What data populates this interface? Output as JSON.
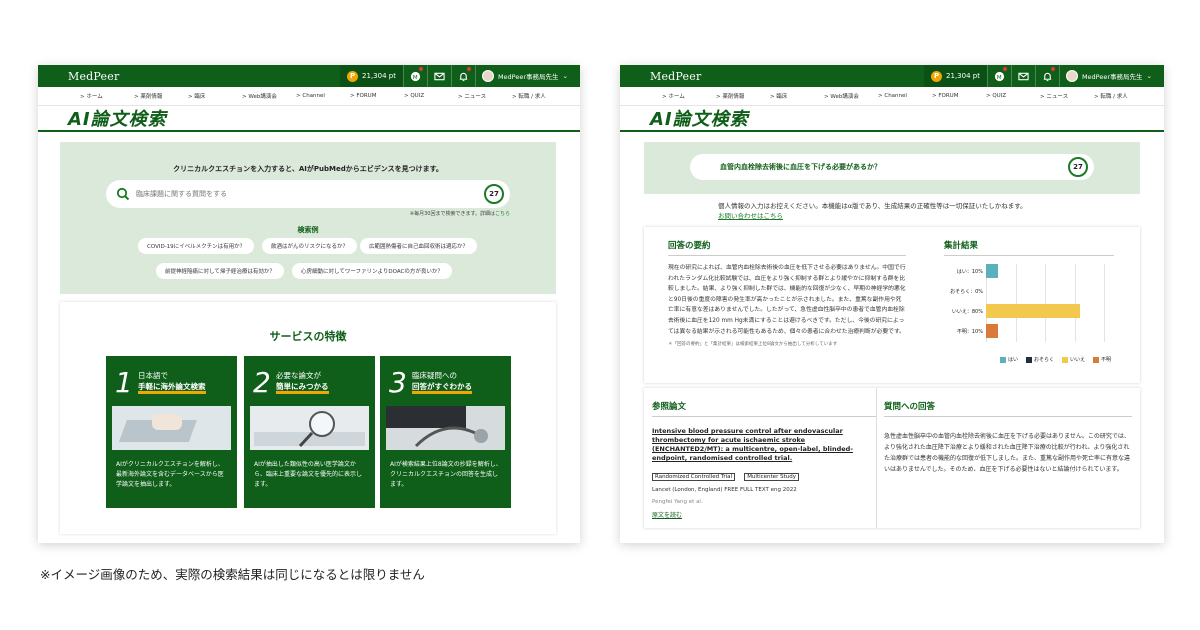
{
  "brand": {
    "logo": "MedPeer",
    "color": "#0f5e19",
    "accent": "#f2a600"
  },
  "topbar": {
    "points": "21,304 pt",
    "icons": [
      {
        "name": "webinar-icon",
        "label": "Webinar"
      },
      {
        "name": "message-icon",
        "label": "メッセージ"
      },
      {
        "name": "bell-icon",
        "label": "お知らせ"
      }
    ],
    "user": "MedPeer事務局先生"
  },
  "nav": [
    "> ホーム",
    "> 薬剤情報",
    "> 臨床",
    "> Web講演会",
    "> Channel",
    "> FORUM",
    "> QUIZ",
    "> ニュース",
    "> 転職 / 求人"
  ],
  "ai_title": "AI論文検索",
  "screen1": {
    "heading": "クリニカルクエスチョンを入力すると、AIがPubMedからエビデンスを見つけます。",
    "search_placeholder": "臨床課題に関する質問をする",
    "ring_count": "27",
    "note": "※毎月30回まで検索できます。詳細は",
    "note_link": "こちら",
    "examples_title": "検索例",
    "examples": [
      "COVID-19にイベルメクチンは有用か？",
      "飲酒はがんのリスクになるか？",
      "広範囲熱傷者に自己血回収術は適応か？",
      "前提神経陥痛に対して帰子経治療は有効か？",
      "心房細動に対してワーファリンよりDOACの方が良いか？"
    ],
    "features_title": "サービスの特徴",
    "features": [
      {
        "num": "1",
        "line1": "日本語で",
        "line2": "手軽に海外論文検索",
        "desc": "AIがクリニカルクエスチョンを解析し、最新海外論文を含むデータベースから医学論文を抽出します。"
      },
      {
        "num": "2",
        "line1": "必要な論文が",
        "line2": "簡単にみつかる",
        "desc": "AIが抽出した類似性の高い医学論文から、臨床上重要な論文を優先的に表示します。"
      },
      {
        "num": "3",
        "line1": "臨床疑問への",
        "line2": "回答がすぐわかる",
        "desc": "AIが検索結果上位8論文の抄録を解析し、クリニカルクエスチョンの回答を生成します。"
      }
    ]
  },
  "screen2": {
    "question": "血管内血栓除去術後に血圧を下げる必要があるか？",
    "ring_count": "27",
    "disclaimer": "個人情報の入力はお控えください。本機能はα版であり、生成結果の正確性等は一切保証いたしかねます。",
    "inquiry_link": "お問い合わせはこちら",
    "summary_title": "回答の要約",
    "summary": "現在の研究によれば、血管内血栓除去術後の血圧を低下させる必要はありません。中国で行われたランダム化比較試験では、血圧をより強く抑制する群とより緩やかに抑制する群を比較しました。結果、より強く抑制した群では、機能的な回復が少なく、早期の神経学的悪化と90日後の重度の障害の発生率が高かったことが示されました。また、重篤な副作用や死亡率に有意な差はありませんでした。したがって、急性虚血性脳卒中の患者で血管内血栓除去術後に血圧を120 mm Hg未満にすることは避けるべきです。ただし、今後の研究によっては異なる結果が示される可能性もあるため、個々の患者に合わせた治療判断が必要です。",
    "summary_footnote": "＊「回答の要約」と「集計結果」は検索結果上位8論文から抽出して分析しています",
    "results_title": "集計結果",
    "chart_data": {
      "type": "bar",
      "categories": [
        "はい",
        "おそらく",
        "いいえ",
        "不明"
      ],
      "labels": [
        "はい：10%",
        "おそらく：0%",
        "いいえ：80%",
        "不明：10%"
      ],
      "values": [
        10,
        0,
        80,
        10
      ],
      "colors": [
        "#5bb0bf",
        "#1f2f3f",
        "#f2c94c",
        "#d97a3a"
      ],
      "legend": [
        "はい",
        "おそらく",
        "いいえ",
        "不明"
      ],
      "xlim": [
        0,
        100
      ]
    },
    "ref_title": "参照論文",
    "ref": {
      "title": "Intensive blood pressure control after endovascular thrombectomy for acute ischaemic stroke (ENCHANTED2/MT): a multicentre, open-label, blinded-endpoint, randomised controlled trial.",
      "tags": [
        "Randomized Controlled Trial",
        "Multicenter Study"
      ],
      "meta": "Lancet (London, England)    FREE FULL TEXT    eng    2022",
      "author": "Pengfei Yang et al.",
      "link": "原文を読む"
    },
    "answer_title": "質問への回答",
    "answer": "急性虚血性脳卒中の血管内血栓除去術後に血圧を下げる必要はありません。この研究では、より強化された血圧降下治療とより緩和された血圧降下治療の比較が行われ、より強化された治療群では患者の機能的な回復が低下しました。また、重篤な副作用や死亡率に有意な違いはありませんでした。そのため、血圧を下げる必要性はないと結論付けられています。"
  },
  "caption": "※イメージ画像のため、実際の検索結果は同じになるとは限りません"
}
